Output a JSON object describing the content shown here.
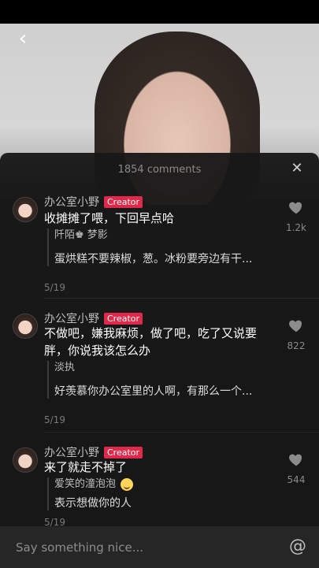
{
  "header": {
    "comments_count_text": "1854 comments"
  },
  "comments": [
    {
      "author": "办公室小野",
      "badge": "Creator",
      "text": "收摊摊了喂，下回早点哈",
      "reply_author": "阡陌♚ 梦影",
      "reply_text": "蛋烘糕不要辣椒，葱。冰粉要旁边有干...",
      "date": "5/19",
      "likes": "1.2k"
    },
    {
      "author": "办公室小野",
      "badge": "Creator",
      "text": "不做吧，嫌我麻烦，做了吧，吃了又说要胖，你说我该怎么办",
      "reply_author": "淡执",
      "reply_text": "好羡慕你办公室里的人啊，有那么一个...",
      "date": "5/19",
      "likes": "822"
    },
    {
      "author": "办公室小野",
      "badge": "Creator",
      "text": "来了就走不掉了",
      "reply_author": "爱笑的潼泡泡",
      "reply_text": "表示想做你的人",
      "date": "5/19",
      "likes": "544"
    }
  ],
  "input": {
    "placeholder": "Say something nice..."
  },
  "icons": {
    "back": "back-arrow-icon",
    "close": "close-icon",
    "like": "heart-icon",
    "mention": "at-icon"
  }
}
